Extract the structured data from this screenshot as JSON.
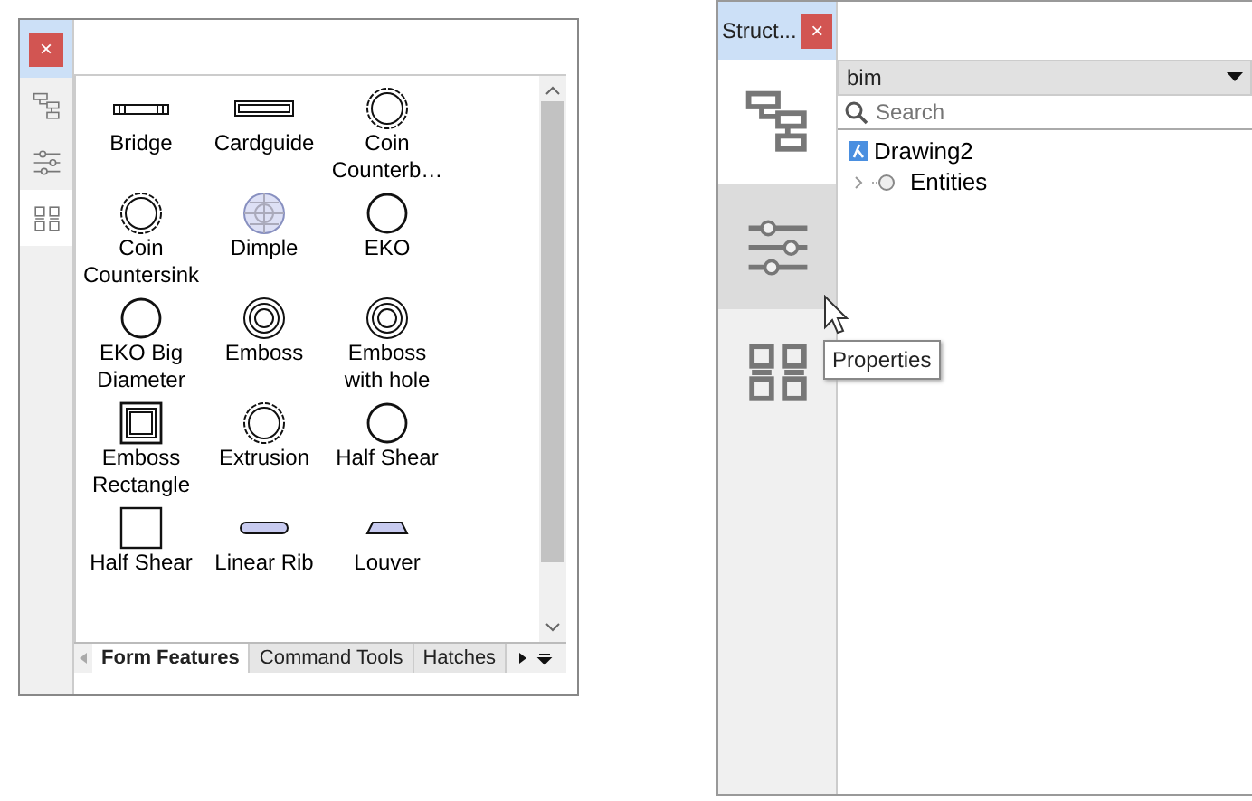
{
  "panels": [
    {
      "kind": "tiles",
      "close": "×",
      "sidebar": [
        {
          "kind": "tree",
          "selected": false,
          "hovered": false
        },
        {
          "kind": "sliders",
          "selected": false,
          "hovered": false
        },
        {
          "kind": "grid",
          "selected": true,
          "hovered": false
        }
      ],
      "tiles": [
        {
          "kind": "slot",
          "label": "Bridge"
        },
        {
          "kind": "bar",
          "label": "Cardguide"
        },
        {
          "kind": "double-ring",
          "label": "Coin Counterb…"
        },
        {
          "kind": "double-ring",
          "label": "Coin Countersink"
        },
        {
          "kind": "mesh",
          "label": "Dimple"
        },
        {
          "kind": "circle",
          "label": "EKO"
        },
        {
          "kind": "circle",
          "label": "EKO Big Diameter"
        },
        {
          "kind": "triple-ring",
          "label": "Emboss"
        },
        {
          "kind": "triple-ring",
          "label": "Emboss with hole"
        },
        {
          "kind": "square-frame",
          "label": "Emboss Rectangle"
        },
        {
          "kind": "double-ring",
          "label": "Extrusion"
        },
        {
          "kind": "circle",
          "label": "Half Shear"
        },
        {
          "kind": "square",
          "label": "Half Shear"
        },
        {
          "kind": "rib",
          "label": "Linear Rib"
        },
        {
          "kind": "trapezoid",
          "label": "Louver"
        }
      ],
      "tabs": [
        {
          "label": "Form Features",
          "selected": true
        },
        {
          "label": "Command Tools",
          "selected": false
        },
        {
          "label": "Hatches",
          "selected": false
        }
      ]
    },
    {
      "kind": "tree",
      "title": "Struct...",
      "close": "×",
      "sidebar": [
        {
          "kind": "tree",
          "selected": true,
          "hovered": false
        },
        {
          "kind": "sliders",
          "selected": false,
          "hovered": true
        },
        {
          "kind": "grid",
          "selected": false,
          "hovered": false
        }
      ],
      "filter": {
        "value": "bim"
      },
      "search": {
        "placeholder": "Search"
      },
      "tree": [
        {
          "label": "Drawing2",
          "children": [
            {
              "label": "Entities",
              "expanded": false
            }
          ]
        }
      ],
      "tooltip": "Properties"
    }
  ]
}
